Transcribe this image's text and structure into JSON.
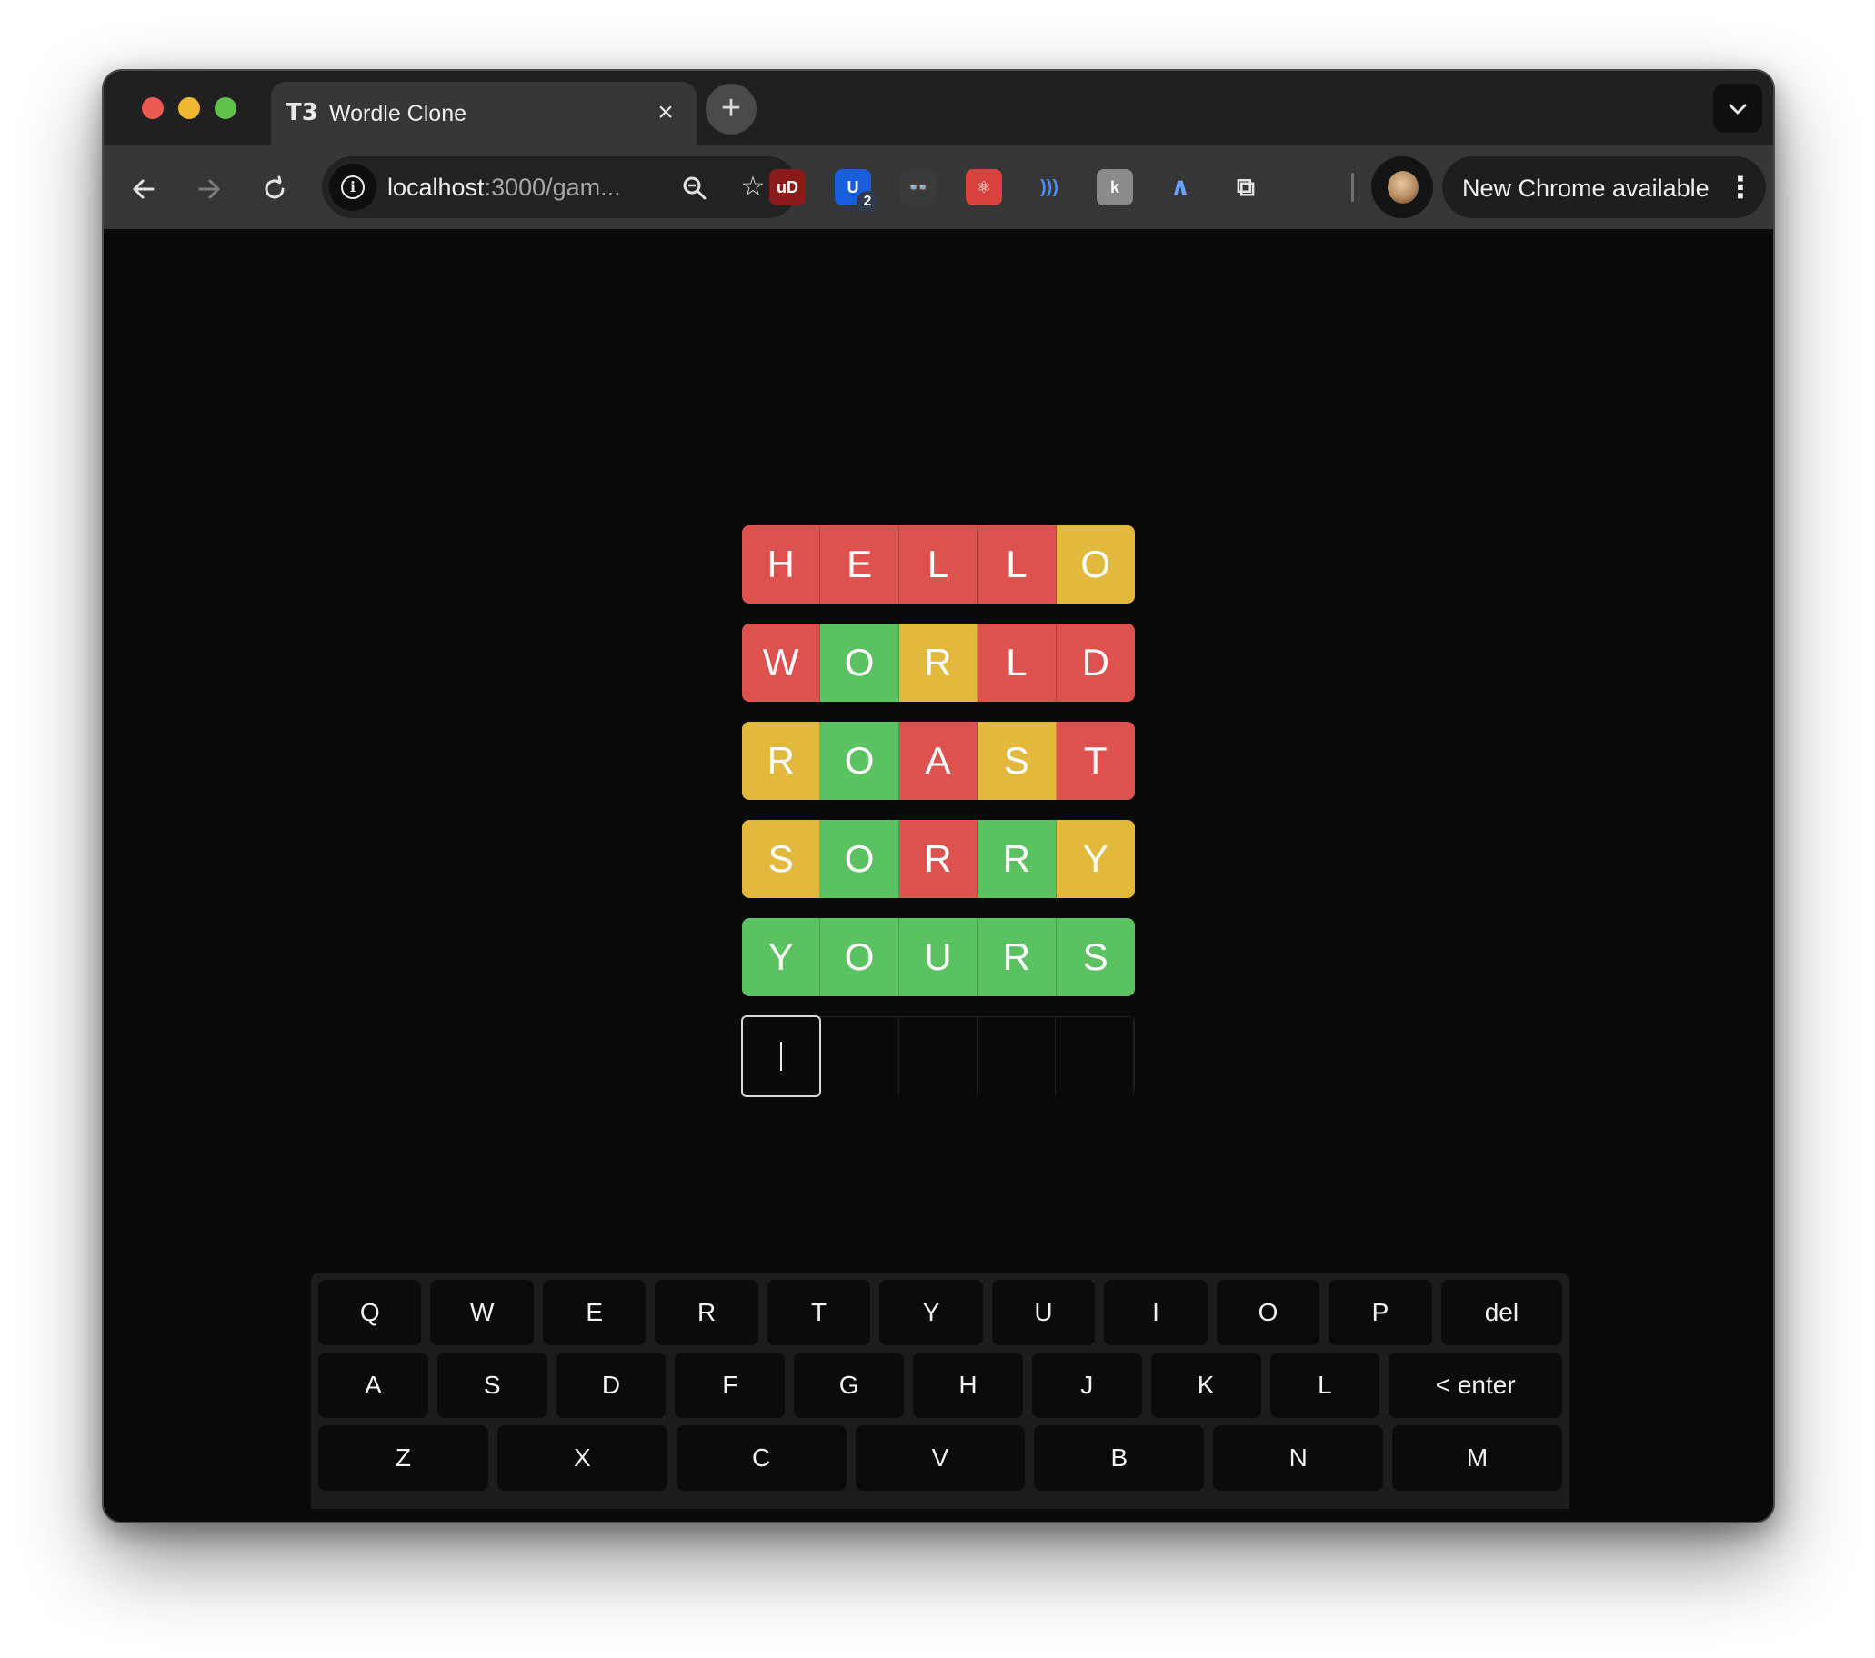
{
  "browser": {
    "tab": {
      "favicon": "T3",
      "title": "Wordle Clone",
      "close": "×"
    },
    "new_tab": "+",
    "tab_search": "⌄",
    "nav": {
      "back": "←",
      "forward": "→",
      "reload": "↻"
    },
    "omnibox": {
      "url_host": "localhost",
      "url_rest": ":3000/gam...",
      "zoom_icon": "⌕",
      "bookmark_icon": "☆"
    },
    "extensions": [
      {
        "name": "ublock-origin",
        "label": "uD",
        "color": "#8b1a1a"
      },
      {
        "name": "bitwarden",
        "label": "U",
        "color": "#175ddc",
        "badge": "2"
      },
      {
        "name": "spy-glasses",
        "label": "👓",
        "color": "#3a3a3a"
      },
      {
        "name": "react-devtools",
        "label": "⚛",
        "color": "#d9423c"
      },
      {
        "name": "wifi-signal",
        "label": ")))",
        "color": "#363636"
      },
      {
        "name": "keyboard-helper",
        "label": "k",
        "color": "#8a8a8a"
      },
      {
        "name": "arc-extension",
        "label": "∧",
        "color": "#363636"
      },
      {
        "name": "puzzle-extensions",
        "label": "⧉",
        "color": "#363636"
      }
    ],
    "update": {
      "text": "New Chrome available",
      "menu": "⋮"
    }
  },
  "board": {
    "rows": [
      {
        "tiles": [
          {
            "letter": "H",
            "state": "absent"
          },
          {
            "letter": "E",
            "state": "absent"
          },
          {
            "letter": "L",
            "state": "absent"
          },
          {
            "letter": "L",
            "state": "absent"
          },
          {
            "letter": "O",
            "state": "present"
          }
        ]
      },
      {
        "tiles": [
          {
            "letter": "W",
            "state": "absent"
          },
          {
            "letter": "O",
            "state": "correct"
          },
          {
            "letter": "R",
            "state": "present"
          },
          {
            "letter": "L",
            "state": "absent"
          },
          {
            "letter": "D",
            "state": "absent"
          }
        ]
      },
      {
        "tiles": [
          {
            "letter": "R",
            "state": "present"
          },
          {
            "letter": "O",
            "state": "correct"
          },
          {
            "letter": "A",
            "state": "absent"
          },
          {
            "letter": "S",
            "state": "present"
          },
          {
            "letter": "T",
            "state": "absent"
          }
        ]
      },
      {
        "tiles": [
          {
            "letter": "S",
            "state": "present"
          },
          {
            "letter": "O",
            "state": "correct"
          },
          {
            "letter": "R",
            "state": "absent"
          },
          {
            "letter": "R",
            "state": "correct"
          },
          {
            "letter": "Y",
            "state": "present"
          }
        ]
      },
      {
        "tiles": [
          {
            "letter": "Y",
            "state": "correct"
          },
          {
            "letter": "O",
            "state": "correct"
          },
          {
            "letter": "U",
            "state": "correct"
          },
          {
            "letter": "R",
            "state": "correct"
          },
          {
            "letter": "S",
            "state": "correct"
          }
        ]
      }
    ],
    "input_row": {
      "tiles": [
        "",
        "",
        "",
        "",
        ""
      ],
      "active_index": 0
    }
  },
  "colors": {
    "absent": "#dd524f",
    "present": "#e2b83d",
    "correct": "#5bc262"
  },
  "keyboard": {
    "row1": [
      "Q",
      "W",
      "E",
      "R",
      "T",
      "Y",
      "U",
      "I",
      "O",
      "P",
      "del"
    ],
    "row2": [
      "A",
      "S",
      "D",
      "F",
      "G",
      "H",
      "J",
      "K",
      "L",
      "< enter"
    ],
    "row3": [
      "Z",
      "X",
      "C",
      "V",
      "B",
      "N",
      "M"
    ]
  }
}
